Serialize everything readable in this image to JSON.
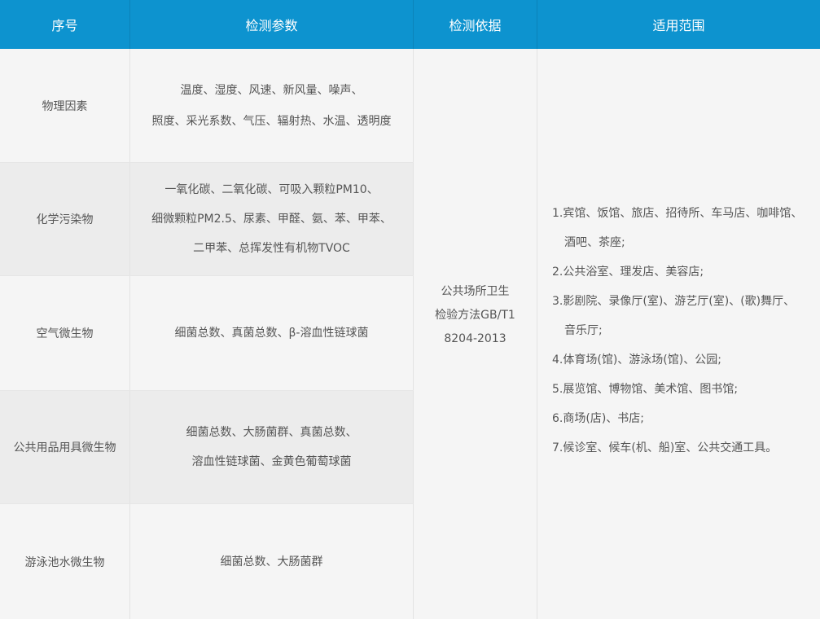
{
  "header": {
    "col1": "序号",
    "col2": "检测参数",
    "col3": "检测依据",
    "col4": "适用范围"
  },
  "rows": [
    {
      "category": "物理因素",
      "params": [
        "温度、湿度、风速、新风量、噪声、",
        "照度、采光系数、气压、辐射热、水温、透明度"
      ]
    },
    {
      "category": "化学污染物",
      "params": [
        "一氧化碳、二氧化碳、可吸入颗粒PM10、",
        "细微颗粒PM2.5、尿素、甲醛、氨、苯、甲苯、",
        "二甲苯、总挥发性有机物TVOC"
      ]
    },
    {
      "category": "空气微生物",
      "params": [
        "细菌总数、真菌总数、β-溶血性链球菌"
      ]
    },
    {
      "category": "公共用品用具微生物",
      "params": [
        "细菌总数、大肠菌群、真菌总数、",
        "溶血性链球菌、金黄色葡萄球菌"
      ]
    },
    {
      "category": "游泳池水微生物",
      "params": [
        "细菌总数、大肠菌群"
      ]
    }
  ],
  "basis": [
    "公共场所卫生",
    "检验方法GB/T1",
    "8204-2013"
  ],
  "scope": [
    "1.宾馆、饭馆、旅店、招待所、车马店、咖啡馆、",
    "酒吧、茶座;",
    "2.公共浴室、理发店、美容店;",
    "3.影剧院、录像厅(室)、游艺厅(室)、(歌)舞厅、",
    "音乐厅;",
    "4.体育场(馆)、游泳场(馆)、公园;",
    "5.展览馆、博物馆、美术馆、图书馆;",
    "6.商场(店)、书店;",
    "7.候诊室、候车(机、船)室、公共交通工具。"
  ]
}
